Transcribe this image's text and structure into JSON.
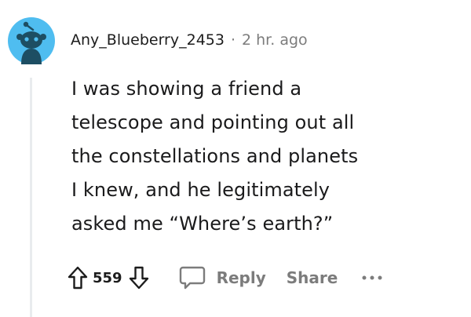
{
  "comment": {
    "author": "Any_Blueberry_2453",
    "separator": "·",
    "time_ago": "2 hr. ago",
    "body_lines": [
      "I was showing a friend a",
      "telescope and pointing out all",
      "the constellations and planets",
      "I knew, and he legitimately",
      "asked me “Where’s earth?”"
    ]
  },
  "actions": {
    "score": "559",
    "reply_label": "Reply",
    "share_label": "Share"
  },
  "icons": {
    "avatar": "snoo-avatar-icon",
    "upvote": "upvote-arrow-icon",
    "downvote": "downvote-arrow-icon",
    "reply": "speech-bubble-icon",
    "more": "more-options-icon"
  },
  "colors": {
    "avatar_bg": "#4fbdf0",
    "snoo_body": "#1d4e63",
    "text_primary": "#1c1c1c",
    "text_meta": "#7c7c7c",
    "thread_line": "#e9ecee"
  }
}
